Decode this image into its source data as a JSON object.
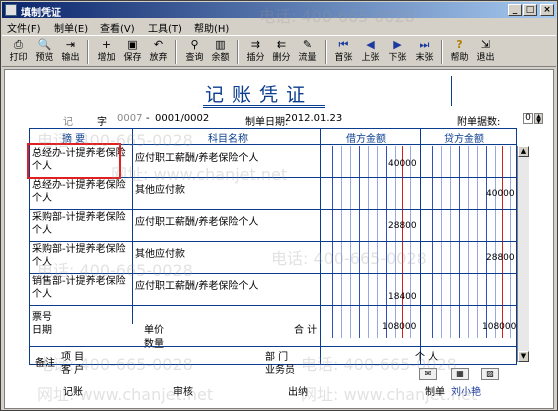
{
  "window": {
    "title": "填制凭证"
  },
  "titlebar_buttons": [
    "_",
    "□",
    "×"
  ],
  "menu": [
    "文件(F)",
    "制单(E)",
    "查看(V)",
    "工具(T)",
    "帮助(H)"
  ],
  "toolbar": [
    {
      "label": "打印",
      "icon": "printer-icon",
      "glyph": "⎙"
    },
    {
      "label": "预览",
      "icon": "preview-icon",
      "glyph": "🔍"
    },
    {
      "label": "输出",
      "icon": "export-icon",
      "glyph": "⇥"
    },
    {
      "label": "增加",
      "icon": "add-icon",
      "glyph": "+"
    },
    {
      "label": "保存",
      "icon": "save-icon",
      "glyph": "▣"
    },
    {
      "label": "放弃",
      "icon": "discard-icon",
      "glyph": "↶"
    },
    {
      "label": "查询",
      "icon": "query-icon",
      "glyph": "⚲"
    },
    {
      "label": "余额",
      "icon": "balance-icon",
      "glyph": "▥"
    },
    {
      "label": "插分",
      "icon": "insert-line-icon",
      "glyph": "⇉"
    },
    {
      "label": "删分",
      "icon": "delete-line-icon",
      "glyph": "⇇"
    },
    {
      "label": "流量",
      "icon": "flow-icon",
      "glyph": "✎"
    },
    {
      "label": "首张",
      "icon": "first-icon",
      "glyph": "⏮"
    },
    {
      "label": "上张",
      "icon": "prev-icon",
      "glyph": "◀"
    },
    {
      "label": "下张",
      "icon": "next-icon",
      "glyph": "▶"
    },
    {
      "label": "末张",
      "icon": "last-icon",
      "glyph": "⏭"
    },
    {
      "label": "帮助",
      "icon": "help-icon",
      "glyph": "?"
    },
    {
      "label": "退出",
      "icon": "exit-icon",
      "glyph": "⇲"
    }
  ],
  "voucher": {
    "title": "记账凭证",
    "type_label": "记",
    "zi_label": "字",
    "number_prefix": "0007",
    "number_sep": "-",
    "number": "0001/0002",
    "date_label": "制单日期:",
    "date": "2012.01.23",
    "attach_label": "附单据数:",
    "attach_count": "0",
    "columns": {
      "summary": "摘 要",
      "account": "科目名称",
      "debit": "借方金额",
      "credit": "贷方金额"
    },
    "entries": [
      {
        "summary": "总经办-计提养老保险个人",
        "account": "应付职工薪酬/养老保险个人",
        "debit": "40000",
        "credit": ""
      },
      {
        "summary": "总经办-计提养老保险个人",
        "account": "其他应付款",
        "debit": "",
        "credit": "40000"
      },
      {
        "summary": "采购部-计提养老保险个人",
        "account": "应付职工薪酬/养老保险个人",
        "debit": "28800",
        "credit": ""
      },
      {
        "summary": "采购部-计提养老保险个人",
        "account": "其他应付款",
        "debit": "",
        "credit": "28800"
      },
      {
        "summary": "销售部-计提养老保险个人",
        "account": "应付职工薪酬/养老保险个人",
        "debit": "18400",
        "credit": ""
      }
    ],
    "bill_no_label": "票号",
    "date_field_label": "日期",
    "unit_price_label": "单价",
    "quantity_label": "数量",
    "total_label": "合 计",
    "total_debit": "108000",
    "total_credit": "108000",
    "memo_label": "备注",
    "project_label": "项  目",
    "customer_label": "客  户",
    "dept_label": "部  门",
    "salesperson_label": "业务员",
    "person_label": "个  人",
    "bookkeeper_label": "记账",
    "auditor_label": "审核",
    "cashier_label": "出纳",
    "maker_label": "制单",
    "maker_name": "刘小艳"
  },
  "watermarks": [
    "电话: 400-665-0028",
    "网址: www.chanjet.net"
  ]
}
